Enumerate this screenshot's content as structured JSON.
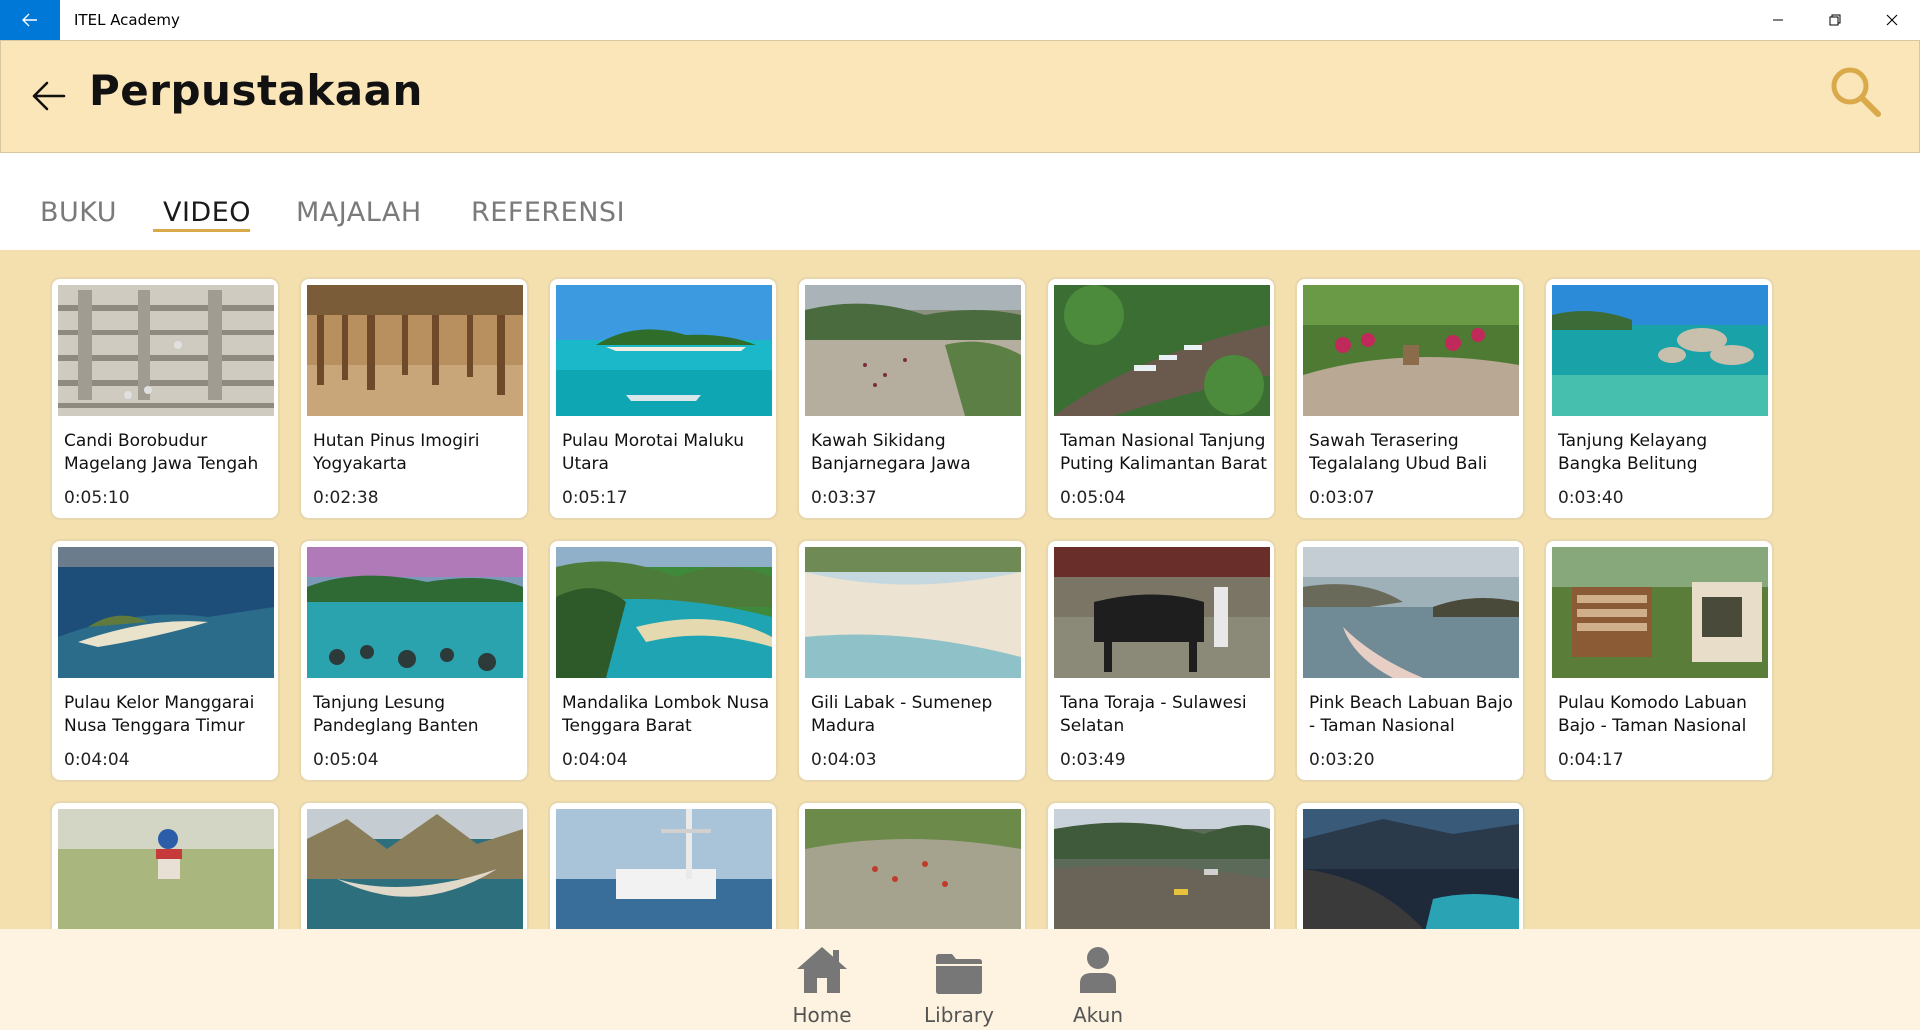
{
  "window": {
    "title": "ITEL Academy"
  },
  "header": {
    "title": "Perpustakaan"
  },
  "tabs": [
    {
      "label": "BUKU",
      "active": false
    },
    {
      "label": "VIDEO",
      "active": true
    },
    {
      "label": "MAJALAH",
      "active": false
    },
    {
      "label": "REFERENSI",
      "active": false
    }
  ],
  "videos": [
    {
      "title": "Candi Borobudur Magelang Jawa Tengah",
      "duration": "0:05:10"
    },
    {
      "title": "Hutan Pinus Imogiri Yogyakarta",
      "duration": "0:02:38"
    },
    {
      "title": "Pulau Morotai Maluku Utara",
      "duration": "0:05:17"
    },
    {
      "title": "Kawah Sikidang Banjarnegara Jawa Tengah",
      "duration": "0:03:37"
    },
    {
      "title": "Taman Nasional Tanjung Puting Kalimantan Barat",
      "duration": "0:05:04"
    },
    {
      "title": "Sawah Terasering Tegalalang Ubud Bali",
      "duration": "0:03:07"
    },
    {
      "title": "Tanjung Kelayang Bangka Belitung",
      "duration": "0:03:40"
    },
    {
      "title": "Pulau Kelor Manggarai Nusa Tenggara Timur",
      "duration": "0:04:04"
    },
    {
      "title": "Tanjung Lesung Pandeglang Banten",
      "duration": "0:05:04"
    },
    {
      "title": "Mandalika Lombok Nusa Tenggara Barat",
      "duration": "0:04:04"
    },
    {
      "title": "Gili Labak - Sumenep Madura",
      "duration": "0:04:03"
    },
    {
      "title": "Tana Toraja - Sulawesi Selatan",
      "duration": "0:03:49"
    },
    {
      "title": "Pink Beach Labuan Bajo - Taman Nasional Komodo",
      "duration": "0:03:20"
    },
    {
      "title": "Pulau Komodo Labuan Bajo - Taman Nasional",
      "duration": "0:04:17"
    },
    {
      "title": "",
      "duration": ""
    },
    {
      "title": "",
      "duration": ""
    },
    {
      "title": "",
      "duration": ""
    },
    {
      "title": "",
      "duration": ""
    },
    {
      "title": "",
      "duration": ""
    },
    {
      "title": "",
      "duration": ""
    }
  ],
  "bottom_nav": [
    {
      "label": "Home",
      "icon": "home-icon"
    },
    {
      "label": "Library",
      "icon": "folder-icon"
    },
    {
      "label": "Akun",
      "icon": "person-icon"
    }
  ],
  "colors": {
    "titlebar_accent": "#0078d7",
    "header_bg": "#fae6b9",
    "content_bg": "#f4dfae",
    "tab_underline": "#d9a94a",
    "search_icon": "#d9a94a"
  }
}
